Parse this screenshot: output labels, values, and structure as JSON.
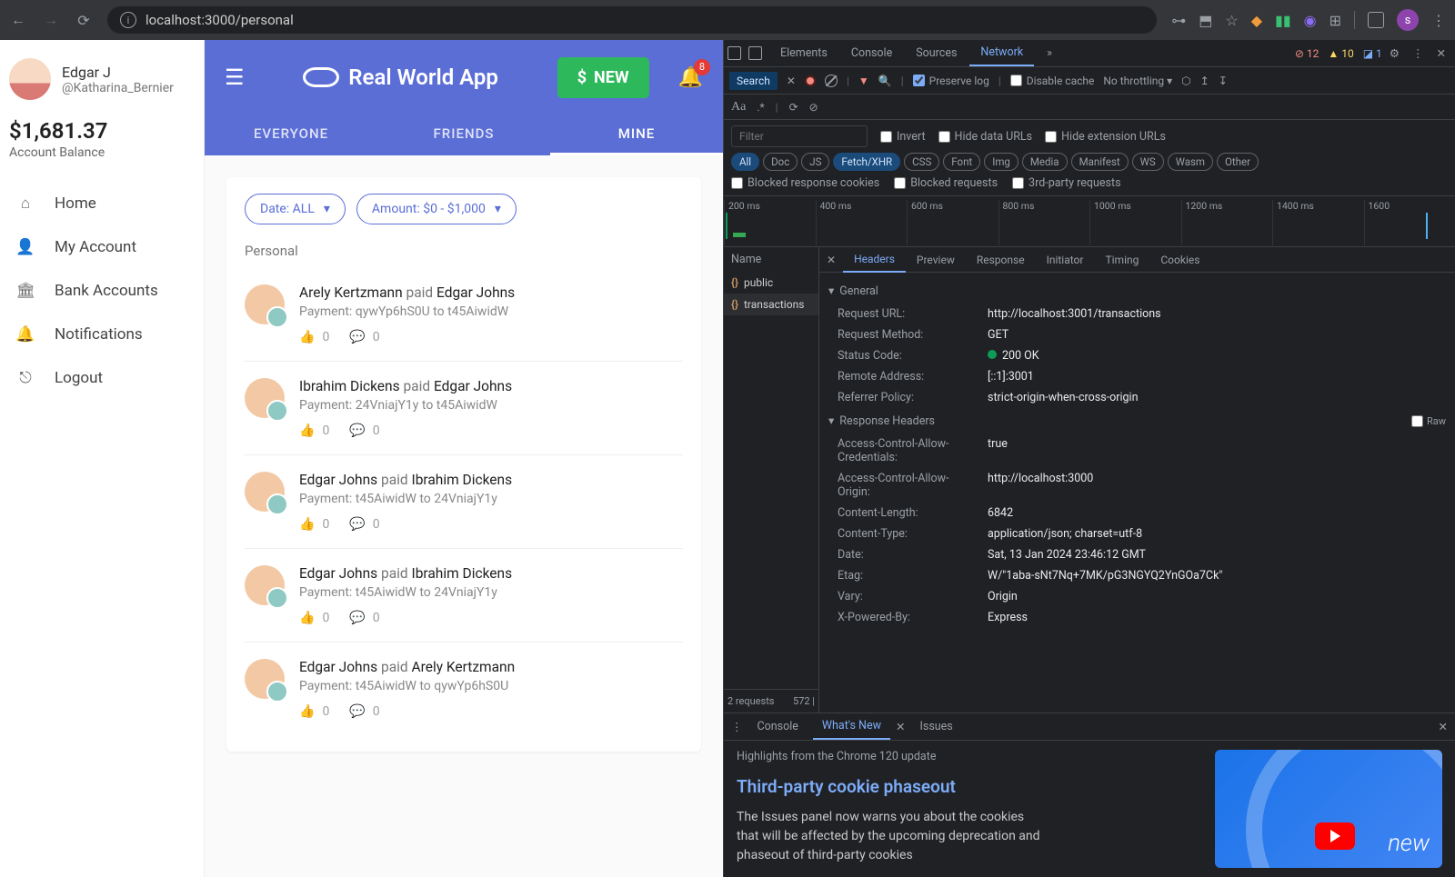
{
  "browser": {
    "url": "localhost:3000/personal",
    "avatar_letter": "s"
  },
  "user": {
    "name": "Edgar J",
    "handle": "@Katharina_Bernier",
    "balance": "$1,681.37",
    "balance_label": "Account Balance"
  },
  "sidebar": {
    "items": [
      {
        "label": "Home"
      },
      {
        "label": "My Account"
      },
      {
        "label": "Bank Accounts"
      },
      {
        "label": "Notifications"
      },
      {
        "label": "Logout"
      }
    ]
  },
  "app": {
    "brand": "Real World App",
    "new_label": "NEW",
    "badge_count": "8",
    "tabs": {
      "everyone": "EVERYONE",
      "friends": "FRIENDS",
      "mine": "MINE"
    },
    "chip_date": "Date: ALL",
    "chip_amount": "Amount: $0 - $1,000",
    "section": "Personal"
  },
  "transactions": [
    {
      "sender": "Arely Kertzmann",
      "verb": "paid",
      "receiver": "Edgar Johns",
      "desc": "Payment: qywYp6hS0U to t45AiwidW",
      "likes": "0",
      "comments": "0"
    },
    {
      "sender": "Ibrahim Dickens",
      "verb": "paid",
      "receiver": "Edgar Johns",
      "desc": "Payment: 24VniajY1y to t45AiwidW",
      "likes": "0",
      "comments": "0"
    },
    {
      "sender": "Edgar Johns",
      "verb": "paid",
      "receiver": "Ibrahim Dickens",
      "desc": "Payment: t45AiwidW to 24VniajY1y",
      "likes": "0",
      "comments": "0"
    },
    {
      "sender": "Edgar Johns",
      "verb": "paid",
      "receiver": "Ibrahim Dickens",
      "desc": "Payment: t45AiwidW to 24VniajY1y",
      "likes": "0",
      "comments": "0"
    },
    {
      "sender": "Edgar Johns",
      "verb": "paid",
      "receiver": "Arely Kertzmann",
      "desc": "Payment: t45AiwidW to qywYp6hS0U",
      "likes": "0",
      "comments": "0"
    }
  ],
  "devtools": {
    "main_tabs": {
      "elements": "Elements",
      "console": "Console",
      "sources": "Sources",
      "network": "Network"
    },
    "issues": {
      "errors": "12",
      "warnings": "10",
      "info": "1"
    },
    "search_label": "Search",
    "preserve_log": "Preserve log",
    "disable_cache": "Disable cache",
    "throttling": "No throttling",
    "filter_placeholder": "Filter",
    "filter_opts": {
      "invert": "Invert",
      "hide_data": "Hide data URLs",
      "hide_ext": "Hide extension URLs"
    },
    "pills": [
      "All",
      "Doc",
      "JS",
      "Fetch/XHR",
      "CSS",
      "Font",
      "Img",
      "Media",
      "Manifest",
      "WS",
      "Wasm",
      "Other"
    ],
    "filter_opts2": {
      "brc": "Blocked response cookies",
      "br": "Blocked requests",
      "tpr": "3rd-party requests"
    },
    "ticks": [
      "200 ms",
      "400 ms",
      "600 ms",
      "800 ms",
      "1000 ms",
      "1200 ms",
      "1400 ms",
      "1600"
    ],
    "name_hdr": "Name",
    "requests": [
      {
        "label": "public"
      },
      {
        "label": "transactions"
      }
    ],
    "footer_left": "2 requests",
    "footer_right": "572 |",
    "detail_tabs": {
      "headers": "Headers",
      "preview": "Preview",
      "response": "Response",
      "initiator": "Initiator",
      "timing": "Timing",
      "cookies": "Cookies"
    },
    "general_label": "General",
    "general": {
      "url_k": "Request URL:",
      "url_v": "http://localhost:3001/transactions",
      "method_k": "Request Method:",
      "method_v": "GET",
      "status_k": "Status Code:",
      "status_v": "200 OK",
      "remote_k": "Remote Address:",
      "remote_v": "[::1]:3001",
      "ref_k": "Referrer Policy:",
      "ref_v": "strict-origin-when-cross-origin"
    },
    "resp_hdr_label": "Response Headers",
    "raw_label": "Raw",
    "response_headers": [
      {
        "k": "Access-Control-Allow-Credentials:",
        "v": "true"
      },
      {
        "k": "Access-Control-Allow-Origin:",
        "v": "http://localhost:3000"
      },
      {
        "k": "Content-Length:",
        "v": "6842"
      },
      {
        "k": "Content-Type:",
        "v": "application/json; charset=utf-8"
      },
      {
        "k": "Date:",
        "v": "Sat, 13 Jan 2024 23:46:12 GMT"
      },
      {
        "k": "Etag:",
        "v": "W/\"1aba-sNt7Nq+7MK/pG3NGYQ2YnGOa7Ck\""
      },
      {
        "k": "Vary:",
        "v": "Origin"
      },
      {
        "k": "X-Powered-By:",
        "v": "Express"
      }
    ],
    "drawer": {
      "tabs": {
        "console": "Console",
        "whatsnew": "What's New",
        "issues": "Issues"
      },
      "highlight": "Highlights from the Chrome 120 update",
      "title": "Third-party cookie phaseout",
      "body": "The Issues panel now warns you about the cookies that will be affected by the upcoming deprecation and phaseout of third-party cookies",
      "promo_word": "new"
    }
  }
}
